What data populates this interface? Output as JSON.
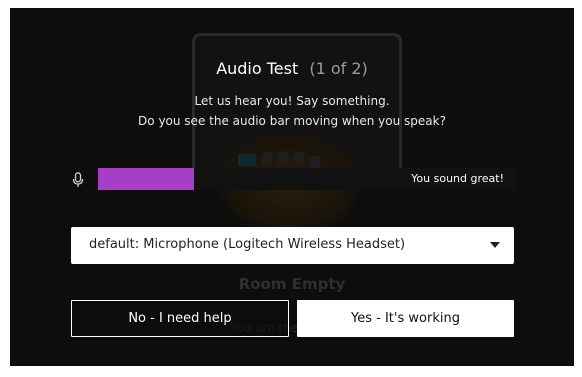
{
  "background": {
    "room_status_title": "Room Empty",
    "room_status_subtitle": "You are the only one"
  },
  "dialog": {
    "title": "Audio Test",
    "step_counter": "(1 of 2)",
    "instruction_line1": "Let us hear you! Say something.",
    "instruction_line2": "Do you see the audio bar moving when you speak?",
    "meter": {
      "level_fraction": 0.23,
      "fill_color": "#a63ec6",
      "status_text": "You sound great!",
      "icon": "microphone-icon"
    },
    "device_select": {
      "selected_value": "default: Microphone (Logitech Wireless Headset)"
    },
    "buttons": {
      "no_label": "No - I need help",
      "yes_label": "Yes - It's working"
    }
  },
  "colors": {
    "backdrop": "#0d0d0d",
    "accent_meter": "#a63ec6"
  }
}
